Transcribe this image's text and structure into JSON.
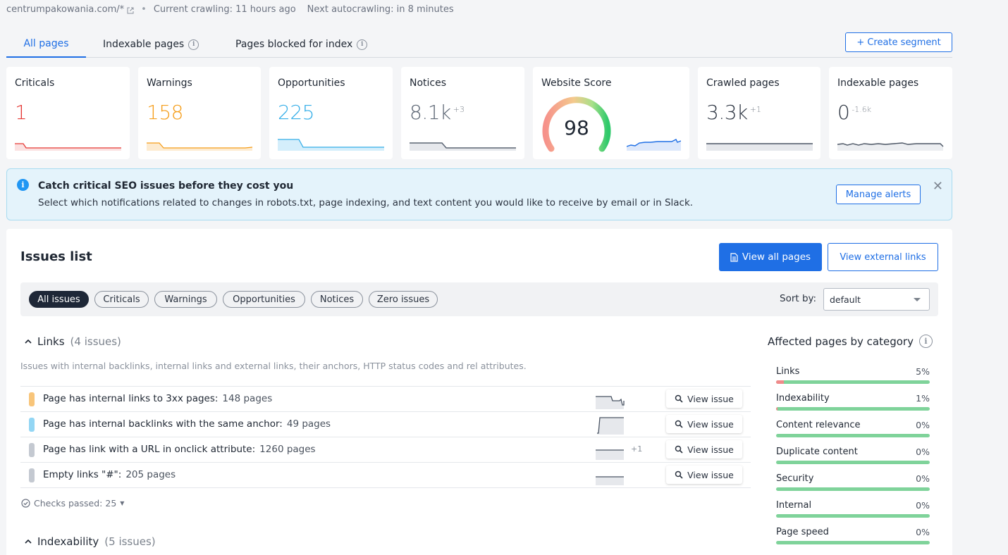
{
  "meta": {
    "domain": "centrumpakowania.com/*",
    "crawling": "Current crawling: 11 hours ago",
    "autocrawl": "Next autocrawling: in 8 minutes"
  },
  "tabs": [
    {
      "label": "All pages"
    },
    {
      "label": "Indexable pages"
    },
    {
      "label": "Pages blocked for index"
    }
  ],
  "create_segment": "+ Create segment",
  "cards": {
    "criticals": {
      "title": "Criticals",
      "value": "1",
      "color": "#e53935"
    },
    "warnings": {
      "title": "Warnings",
      "value": "158",
      "color": "#f59e1b"
    },
    "opportunities": {
      "title": "Opportunities",
      "value": "225",
      "color": "#35aee8"
    },
    "notices": {
      "title": "Notices",
      "value": "8.1k",
      "delta": "+3",
      "color": "#5b6573"
    },
    "score": {
      "title": "Website Score",
      "value": "98"
    },
    "crawled": {
      "title": "Crawled pages",
      "value": "3.3k",
      "delta": "+1"
    },
    "indexable": {
      "title": "Indexable pages",
      "value": "0",
      "delta": "-1.6k"
    }
  },
  "alert": {
    "heading": "Catch critical SEO issues before they cost you",
    "body": "Select which notifications related to changes in robots.txt, page indexing, and text content you would like to receive by email or in Slack.",
    "button": "Manage alerts"
  },
  "issues": {
    "title": "Issues list",
    "view_all": "View all pages",
    "view_external": "View external links",
    "filters": [
      "All issues",
      "Criticals",
      "Warnings",
      "Opportunities",
      "Notices",
      "Zero issues"
    ],
    "sort_label": "Sort by:",
    "sort_value": "default",
    "links_section": {
      "name": "Links",
      "count": "(4 issues)",
      "desc": "Issues with internal backlinks, internal links and external links, their anchors, HTTP status codes and rel attributes."
    },
    "rows": [
      {
        "label": "Page has internal links to 3xx pages:",
        "pages": "148 pages",
        "color": "#f8c57a",
        "plus": ""
      },
      {
        "label": "Page has internal backlinks with the same anchor:",
        "pages": "49 pages",
        "color": "#93d6f4",
        "plus": ""
      },
      {
        "label": "Page has link with a URL in onclick attribute:",
        "pages": "1260 pages",
        "color": "#c4c9d1",
        "plus": "+1"
      },
      {
        "label": "Empty links \"#\":",
        "pages": "205 pages",
        "color": "#c4c9d1",
        "plus": ""
      }
    ],
    "view_issue": "View issue",
    "checks_passed": "Checks passed: 25",
    "indexability_section": {
      "name": "Indexability",
      "count": "(5 issues)"
    }
  },
  "affected": {
    "title": "Affected pages by category",
    "categories": [
      {
        "name": "Links",
        "value": "5%",
        "pct": 5
      },
      {
        "name": "Indexability",
        "value": "1%",
        "pct": 1
      },
      {
        "name": "Content relevance",
        "value": "0%",
        "pct": 0
      },
      {
        "name": "Duplicate content",
        "value": "0%",
        "pct": 0
      },
      {
        "name": "Security",
        "value": "0%",
        "pct": 0
      },
      {
        "name": "Internal",
        "value": "0%",
        "pct": 0
      },
      {
        "name": "Page speed",
        "value": "0%",
        "pct": 0
      }
    ]
  }
}
